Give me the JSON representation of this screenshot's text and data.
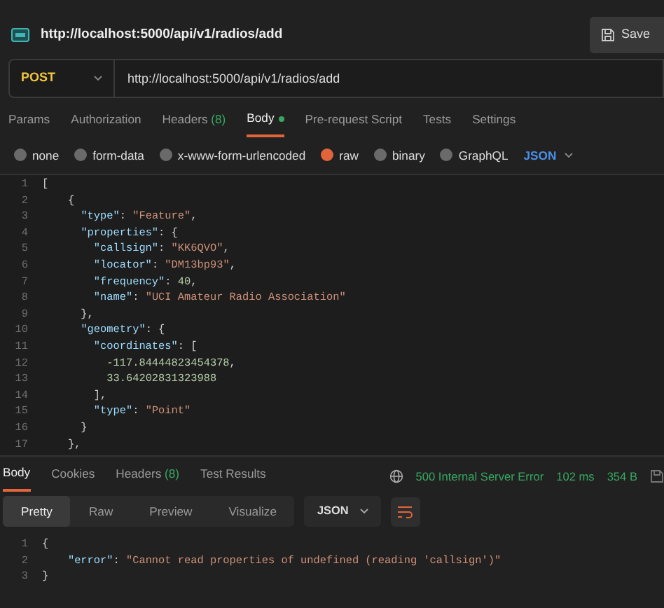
{
  "header": {
    "url": "http://localhost:5000/api/v1/radios/add",
    "save": "Save"
  },
  "request": {
    "method": "POST",
    "url": "http://localhost:5000/api/v1/radios/add"
  },
  "request_tabs": [
    {
      "label": "Params",
      "selected": false,
      "has_content": false
    },
    {
      "label": "Authorization",
      "selected": false,
      "has_content": false
    },
    {
      "label": "Headers",
      "count": "(8)",
      "selected": false,
      "has_content": false
    },
    {
      "label": "Body",
      "selected": true,
      "has_content": true
    },
    {
      "label": "Pre-request Script",
      "selected": false,
      "has_content": false
    },
    {
      "label": "Tests",
      "selected": false,
      "has_content": false
    },
    {
      "label": "Settings",
      "selected": false,
      "has_content": false
    }
  ],
  "body_types": [
    {
      "label": "none",
      "selected": false
    },
    {
      "label": "form-data",
      "selected": false
    },
    {
      "label": "x-www-form-urlencoded",
      "selected": false
    },
    {
      "label": "raw",
      "selected": true
    },
    {
      "label": "binary",
      "selected": false
    },
    {
      "label": "GraphQL",
      "selected": false
    }
  ],
  "body_language": "JSON",
  "editor_lines": [
    {
      "number": "1",
      "code": "["
    },
    {
      "number": "2",
      "code": "    {"
    },
    {
      "number": "3",
      "code": "      \"type\": \"Feature\","
    },
    {
      "number": "4",
      "code": "      \"properties\": {"
    },
    {
      "number": "5",
      "code": "        \"callsign\": \"KK6QVO\","
    },
    {
      "number": "6",
      "code": "        \"locator\": \"DM13bp93\","
    },
    {
      "number": "7",
      "code": "        \"frequency\": 40,"
    },
    {
      "number": "8",
      "code": "        \"name\": \"UCI Amateur Radio Association\""
    },
    {
      "number": "9",
      "code": "      },"
    },
    {
      "number": "10",
      "code": "      \"geometry\": {"
    },
    {
      "number": "11",
      "code": "        \"coordinates\": ["
    },
    {
      "number": "12",
      "code": "          -117.84444823454378,"
    },
    {
      "number": "13",
      "code": "          33.64202831323988"
    },
    {
      "number": "14",
      "code": "        ],"
    },
    {
      "number": "15",
      "code": "        \"type\": \"Point\""
    },
    {
      "number": "16",
      "code": "      }"
    },
    {
      "number": "17",
      "code": "    },"
    }
  ],
  "response_tabs": [
    {
      "label": "Body",
      "selected": true
    },
    {
      "label": "Cookies",
      "selected": false
    },
    {
      "label": "Headers",
      "count": "(8)",
      "selected": false
    },
    {
      "label": "Test Results",
      "selected": false
    }
  ],
  "status": {
    "code": "500 Internal Server Error",
    "time": "102 ms",
    "size": "354 B"
  },
  "view_modes": [
    {
      "label": "Pretty",
      "selected": true
    },
    {
      "label": "Raw",
      "selected": false
    },
    {
      "label": "Preview",
      "selected": false
    },
    {
      "label": "Visualize",
      "selected": false
    }
  ],
  "response_format": "JSON",
  "response_lines": [
    {
      "number": "1",
      "code": "{"
    },
    {
      "number": "2",
      "code": "    \"error\": \"Cannot read properties of undefined (reading 'callsign')\""
    },
    {
      "number": "3",
      "code": "}"
    }
  ]
}
